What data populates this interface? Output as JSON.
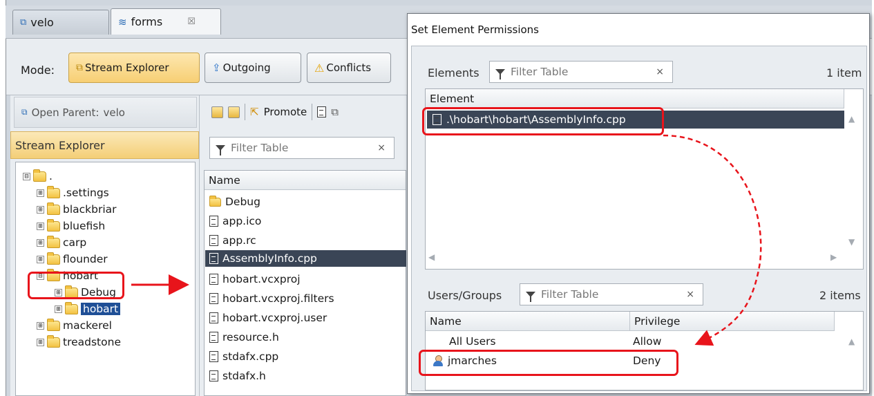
{
  "tabs": [
    {
      "label": "velo",
      "icon": "stream-icon",
      "active": false
    },
    {
      "label": "forms",
      "icon": "workspace-icon",
      "active": true,
      "close": "☒"
    }
  ],
  "mode": {
    "label": "Mode:",
    "buttons": [
      {
        "label": "Stream Explorer",
        "icon": "stream-explorer-icon",
        "selected": true
      },
      {
        "label": "Outgoing",
        "icon": "outgoing-icon",
        "selected": false
      },
      {
        "label": "Conflicts",
        "icon": "warning-icon",
        "selected": false
      }
    ]
  },
  "left": {
    "open_parent_label": "Open Parent:",
    "open_parent_value": "velo",
    "panel_title": "Stream Explorer",
    "tree": [
      {
        "label": ".",
        "expander": "⊟"
      },
      {
        "label": ".settings",
        "expander": "⊞"
      },
      {
        "label": "blackbriar",
        "expander": "⊞"
      },
      {
        "label": "bluefish",
        "expander": "⊞"
      },
      {
        "label": "carp",
        "expander": "⊞"
      },
      {
        "label": "flounder",
        "expander": "⊞"
      },
      {
        "label": "hobart",
        "expander": "⊟"
      },
      {
        "label": "Debug",
        "expander": "⊞"
      },
      {
        "label": "hobart",
        "expander": "⊞",
        "selected": true
      },
      {
        "label": "mackerel",
        "expander": "⊞"
      },
      {
        "label": "treadstone",
        "expander": "⊞"
      }
    ]
  },
  "middle": {
    "toolbar": {
      "promote_label": "Promote"
    },
    "filter_placeholder": "Filter Table",
    "filter_clear": "×",
    "column_name": "Name",
    "files": [
      {
        "name": "Debug",
        "type": "folder"
      },
      {
        "name": "app.ico",
        "type": "file"
      },
      {
        "name": "app.rc",
        "type": "file"
      },
      {
        "name": "AssemblyInfo.cpp",
        "type": "file",
        "selected": true
      },
      {
        "name": "hobart.vcxproj",
        "type": "file"
      },
      {
        "name": "hobart.vcxproj.filters",
        "type": "file"
      },
      {
        "name": "hobart.vcxproj.user",
        "type": "file"
      },
      {
        "name": "resource.h",
        "type": "file"
      },
      {
        "name": "stdafx.cpp",
        "type": "file"
      },
      {
        "name": "stdafx.h",
        "type": "file"
      }
    ]
  },
  "dialog": {
    "title": "Set Element Permissions",
    "elements": {
      "label": "Elements",
      "filter_placeholder": "Filter Table",
      "filter_clear": "×",
      "count": "1 item",
      "column": "Element",
      "rows": [
        ".\\hobart\\hobart\\AssemblyInfo.cpp"
      ]
    },
    "users": {
      "label": "Users/Groups",
      "filter_placeholder": "Filter Table",
      "filter_clear": "×",
      "count": "2 items",
      "columns": [
        "Name",
        "Privilege"
      ],
      "rows": [
        {
          "name": "All Users",
          "privilege": "Allow",
          "icon": ""
        },
        {
          "name": "jmarches",
          "privilege": "Deny",
          "icon": "user-icon"
        }
      ]
    }
  },
  "colors": {
    "annotation": "#e8141b",
    "selection": "#1f4f96",
    "row_highlight": "#3a4556",
    "accent": "#f4cf77"
  }
}
